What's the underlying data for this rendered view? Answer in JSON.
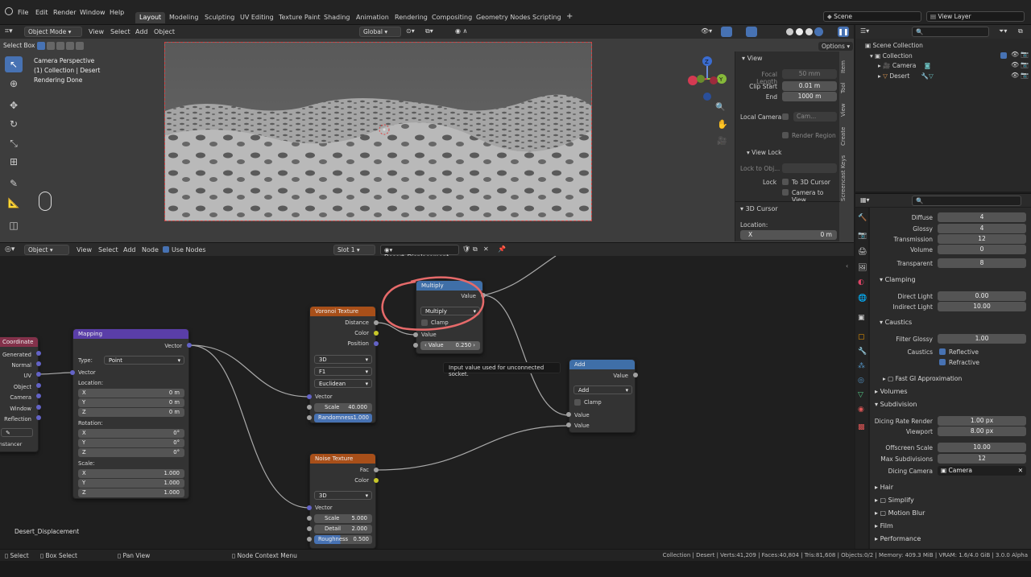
{
  "menu": [
    "File",
    "Edit",
    "Render",
    "Window",
    "Help"
  ],
  "workspaces": [
    "Layout",
    "Modeling",
    "Sculpting",
    "UV Editing",
    "Texture Paint",
    "Shading",
    "Animation",
    "Rendering",
    "Compositing",
    "Geometry Nodes",
    "Scripting"
  ],
  "active_workspace": "Layout",
  "scene": "Scene",
  "view_layer": "View Layer",
  "viewport": {
    "mode": "Object Mode",
    "menus": [
      "View",
      "Select",
      "Add",
      "Object"
    ],
    "orientation": "Global",
    "select_box": "Select Box",
    "options": "Options",
    "overlay_lines": [
      "Camera Perspective",
      "(1) Collection | Desert",
      "Rendering Done"
    ]
  },
  "npanel": {
    "view_header": "View",
    "focal_length_label": "Focal Length",
    "focal_length": "50 mm",
    "clip_start_label": "Clip Start",
    "clip_start": "0.01 m",
    "end_label": "End",
    "end": "1000 m",
    "local_camera_label": "Local Camera",
    "local_camera_value": "Cam...",
    "render_region": "Render Region",
    "view_lock_header": "View Lock",
    "lock_to_obj": "Lock to Obj...",
    "lock_label": "Lock",
    "to_3d_cursor": "To 3D Cursor",
    "camera_to_view": "Camera to View",
    "cursor_header": "3D Cursor",
    "location_label": "Location:",
    "x_label": "X",
    "x_value": "0 m",
    "tabs": [
      "Item",
      "Tool",
      "View",
      "Create",
      "Screencast Keys"
    ]
  },
  "outliner": {
    "root": "Scene Collection",
    "collection": "Collection",
    "items": [
      "Camera",
      "Desert"
    ]
  },
  "properties": {
    "rows": [
      {
        "label": "Diffuse",
        "value": "4"
      },
      {
        "label": "Glossy",
        "value": "4"
      },
      {
        "label": "Transmission",
        "value": "12"
      },
      {
        "label": "Volume",
        "value": "0"
      },
      {
        "label": "Transparent",
        "value": "8"
      }
    ],
    "clamping": "Clamping",
    "direct_light_label": "Direct Light",
    "direct_light": "0.00",
    "indirect_light_label": "Indirect Light",
    "indirect_light": "10.00",
    "caustics_header": "Caustics",
    "filter_glossy_label": "Filter Glossy",
    "filter_glossy": "1.00",
    "caustics_label": "Caustics",
    "reflective": "Reflective",
    "refractive": "Refractive",
    "fast_gi": "Fast GI Approximation",
    "volumes": "Volumes",
    "subdivision": "Subdivision",
    "dicing_rate_render_label": "Dicing Rate Render",
    "dicing_rate_render": "1.00 px",
    "viewport_label": "Viewport",
    "viewport_value": "8.00 px",
    "offscreen_scale_label": "Offscreen Scale",
    "offscreen_scale": "10.00",
    "max_subdivisions_label": "Max Subdivisions",
    "max_subdivisions": "12",
    "dicing_camera_label": "Dicing Camera",
    "dicing_camera": "Camera",
    "bottom_sections": [
      "Hair",
      "Simplify",
      "Motion Blur",
      "Film",
      "Performance"
    ]
  },
  "node_editor": {
    "type": "Object",
    "menus": [
      "View",
      "Select",
      "Add",
      "Node"
    ],
    "use_nodes": "Use Nodes",
    "slot": "Slot 1",
    "material": "Desert_Displacement",
    "material_label": "Desert_Displacement",
    "tooltip": "Input value used for unconnected socket."
  },
  "nodes": {
    "coordinate": {
      "title": "Coordinate",
      "outputs": [
        "Generated",
        "Normal",
        "UV",
        "Object",
        "Camera",
        "Window",
        "Reflection"
      ],
      "instancer": "Instancer"
    },
    "mapping": {
      "title": "Mapping",
      "vector_out": "Vector",
      "type_label": "Type:",
      "type_value": "Point",
      "vector_in": "Vector",
      "location": "Location:",
      "rotation": "Rotation:",
      "scale": "Scale:",
      "axes": [
        "X",
        "Y",
        "Z"
      ],
      "loc": [
        "0 m",
        "0 m",
        "0 m"
      ],
      "rot": [
        "0°",
        "0°",
        "0°"
      ],
      "scl": [
        "1.000",
        "1.000",
        "1.000"
      ]
    },
    "voronoi": {
      "title": "Voronoi Texture",
      "outputs": [
        "Distance",
        "Color",
        "Position"
      ],
      "dim": "3D",
      "feature": "F1",
      "metric": "Euclidean",
      "vector": "Vector",
      "scale_label": "Scale",
      "scale": "40.000",
      "randomness_label": "Randomness",
      "randomness": "1.000"
    },
    "multiply": {
      "title": "Multiply",
      "value_out": "Value",
      "op": "Multiply",
      "clamp": "Clamp",
      "value_in": "Value",
      "value_label": "Value",
      "value": "0.250"
    },
    "add": {
      "title": "Add",
      "value_out": "Value",
      "op": "Add",
      "clamp": "Clamp",
      "in1": "Value",
      "in2": "Value"
    },
    "noise": {
      "title": "Noise Texture",
      "outputs": [
        "Fac",
        "Color"
      ],
      "dim": "3D",
      "vector": "Vector",
      "scale_label": "Scale",
      "scale": "5.000",
      "detail_label": "Detail",
      "detail": "2.000",
      "roughness_label": "Roughness",
      "roughness": "0.500"
    }
  },
  "statusbar": {
    "select": "Select",
    "box_select": "Box Select",
    "pan_view": "Pan View",
    "context_menu": "Node Context Menu",
    "stats": "Collection | Desert | Verts:41,209 | Faces:40,804 | Tris:81,608 | Objects:0/2 | Memory: 409.3 MiB | VRAM: 1.6/4.0 GiB | 3.0.0 Alpha"
  },
  "colors": {
    "accent": "#4772b3",
    "node_input": "#83314a",
    "node_vector": "#3c3c83",
    "node_texture": "#a84f19",
    "node_converter": "#3f6fa8",
    "annotation": "#e66a6a"
  }
}
